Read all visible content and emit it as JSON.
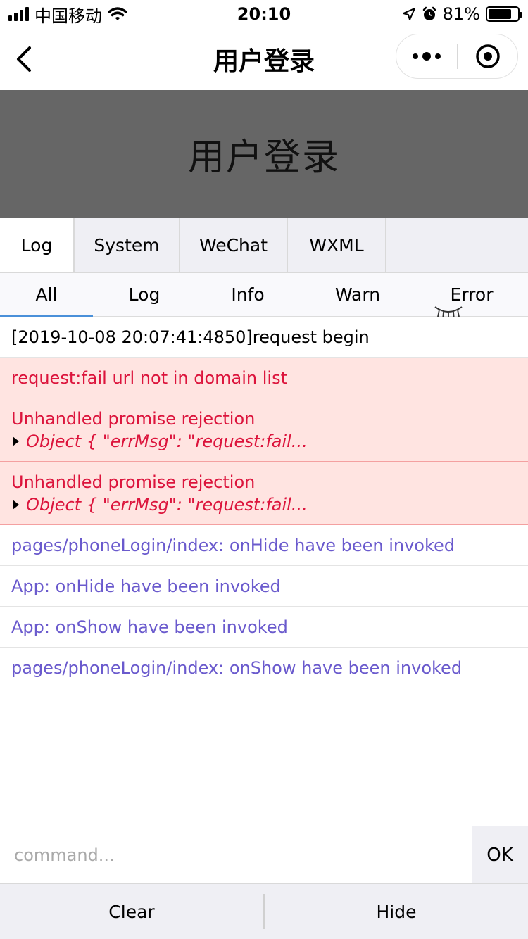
{
  "status_bar": {
    "carrier": "中国移动",
    "time": "20:10",
    "battery_pct": "81%",
    "battery_level": 0.81
  },
  "nav": {
    "title": "用户登录"
  },
  "banner": {
    "title": "用户登录"
  },
  "main_tabs": [
    {
      "label": "Log",
      "active": true
    },
    {
      "label": "System",
      "active": false
    },
    {
      "label": "WeChat",
      "active": false
    },
    {
      "label": "WXML",
      "active": false
    }
  ],
  "sub_tabs": [
    {
      "label": "All",
      "active": true
    },
    {
      "label": "Log",
      "active": false
    },
    {
      "label": "Info",
      "active": false
    },
    {
      "label": "Warn",
      "active": false
    },
    {
      "label": "Error",
      "active": false
    }
  ],
  "logs": [
    {
      "type": "normal",
      "text": "[2019-10-08 20:07:41:4850]request begin"
    },
    {
      "type": "error",
      "text": "request:fail url not in domain list"
    },
    {
      "type": "error",
      "text": "Unhandled promise rejection",
      "object": "Object { \"errMsg\": \"request:fail..."
    },
    {
      "type": "error",
      "text": "Unhandled promise rejection",
      "object": "Object { \"errMsg\": \"request:fail..."
    },
    {
      "type": "info",
      "text": "pages/phoneLogin/index: onHide have been invoked"
    },
    {
      "type": "info",
      "text": "App: onHide have been invoked"
    },
    {
      "type": "info",
      "text": "App: onShow have been invoked"
    },
    {
      "type": "info",
      "text": "pages/phoneLogin/index: onShow have been invoked"
    }
  ],
  "command": {
    "placeholder": "command...",
    "ok_label": "OK"
  },
  "toolbar": {
    "clear_label": "Clear",
    "hide_label": "Hide"
  },
  "colors": {
    "error_text": "#dc143c",
    "error_bg": "#ffe4e1",
    "info_text": "#6a5acd",
    "banner_bg": "#666666",
    "tab_bg": "#efeff4"
  }
}
